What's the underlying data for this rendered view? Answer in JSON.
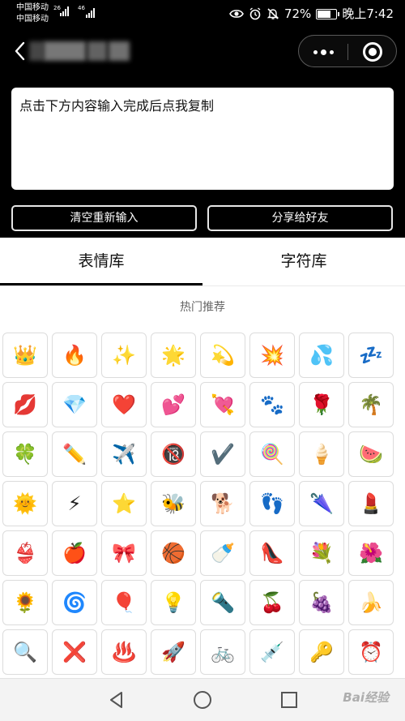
{
  "status_bar": {
    "carrier_1": "中国移动",
    "carrier_2": "中国移动",
    "net_1": "26",
    "net_2": "46",
    "battery_text": "72%",
    "battery_level": 0.72,
    "time": "晚上7:42",
    "icons": [
      "eye-icon",
      "alarm-icon",
      "mute-icon",
      "battery-icon"
    ]
  },
  "header": {
    "back_icon": "chevron-left-icon",
    "more_icon": "more-dots-icon",
    "close_icon": "target-circle-icon"
  },
  "input": {
    "placeholder": "点击下方内容输入完成后点我复制",
    "value": ""
  },
  "buttons": {
    "clear": "清空重新输入",
    "share": "分享给好友"
  },
  "tabs": {
    "emoji": "表情库",
    "chars": "字符库",
    "active": "emoji"
  },
  "section": {
    "title": "热门推荐"
  },
  "emojis": [
    "👑",
    "🔥",
    "✨",
    "🌟",
    "💫",
    "💥",
    "💦",
    "💤",
    "💋",
    "💎",
    "❤️",
    "💕",
    "💘",
    "🐾",
    "🌹",
    "🌴",
    "🍀",
    "✏️",
    "✈️",
    "🔞",
    "✔️",
    "🍭",
    "🍦",
    "🍉",
    "🌞",
    "⚡",
    "⭐",
    "🐝",
    "🐕",
    "👣",
    "🌂",
    "💄",
    "👙",
    "🍎",
    "🎀",
    "🏀",
    "🍼",
    "👠",
    "💐",
    "🌺",
    "🌻",
    "🌀",
    "🎈",
    "💡",
    "🔦",
    "🍒",
    "🍇",
    "🍌",
    "🔍",
    "❌",
    "♨️",
    "🚀",
    "🚲",
    "💉",
    "🔑",
    "⏰"
  ],
  "nav": {
    "back_icon": "triangle-back-icon",
    "home_icon": "circle-home-icon",
    "recent_icon": "square-recent-icon"
  },
  "watermark": "Bai经验",
  "colors": {
    "bar_bg": "#000000",
    "page_bg": "#ffffff",
    "cell_border": "#dcdcdc",
    "text": "#111111"
  }
}
